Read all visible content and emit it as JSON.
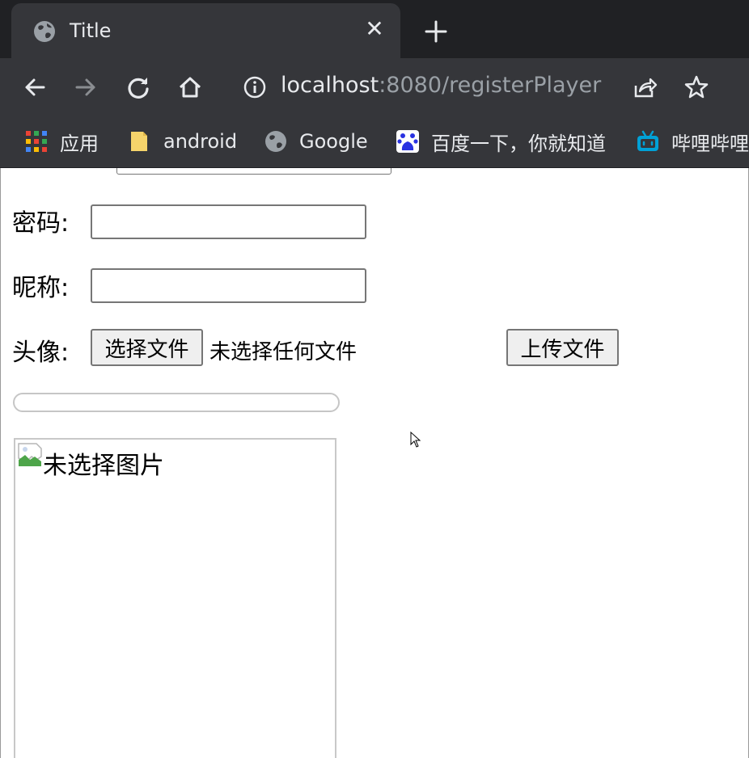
{
  "browser": {
    "tab": {
      "title": "Title",
      "close_icon": "close-icon",
      "favicon": "globe-icon"
    },
    "new_tab_icon": "plus-icon",
    "toolbar": {
      "back_icon": "arrow-left-icon",
      "forward_icon": "arrow-right-icon",
      "reload_icon": "reload-icon",
      "home_icon": "home-icon",
      "site_info_icon": "info-icon",
      "url_host": "localhost",
      "url_rest": ":8080/registerPlayer",
      "share_icon": "share-icon",
      "bookmark_icon": "star-icon"
    },
    "bookmarks": [
      {
        "label": "应用",
        "icon": "apps-grid-icon"
      },
      {
        "label": "android",
        "icon": "folder-icon"
      },
      {
        "label": "Google",
        "icon": "globe-icon"
      },
      {
        "label": "百度一下，你就知道",
        "icon": "baidu-icon"
      },
      {
        "label": "哔哩哔哩",
        "icon": "bilibili-icon"
      }
    ]
  },
  "form": {
    "password": {
      "label": "密码:",
      "value": ""
    },
    "nickname": {
      "label": "昵称:",
      "value": ""
    },
    "avatar": {
      "label": "头像:",
      "choose_button": "选择文件",
      "file_status": "未选择任何文件",
      "upload_button": "上传文件"
    },
    "upload_progress": 0,
    "preview": {
      "alt_text": "未选择图片",
      "icon": "broken-image-icon"
    }
  },
  "colors": {
    "chrome_dark": "#202124",
    "chrome_toolbar": "#35363a",
    "chrome_text": "#e8eaed",
    "url_dim": "#9aa0a6",
    "input_border": "#767676",
    "button_bg": "#efefef"
  }
}
